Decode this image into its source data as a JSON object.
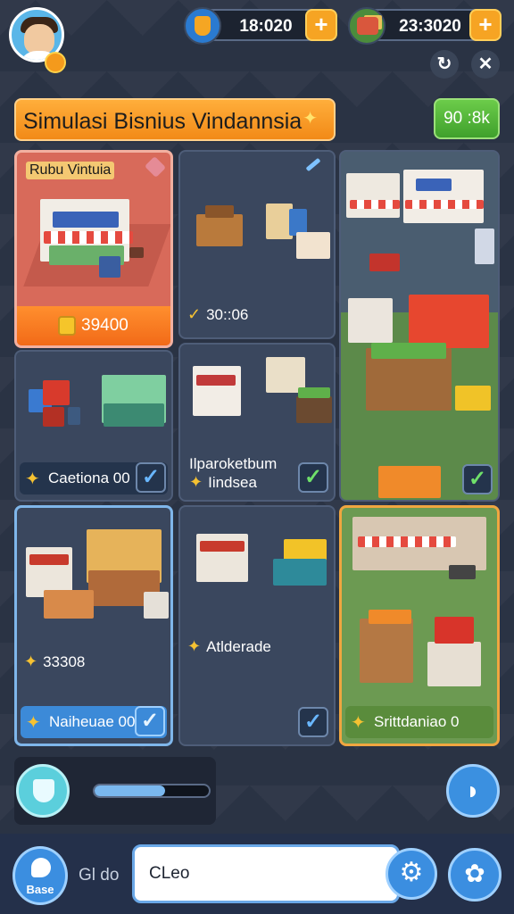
{
  "header": {
    "currency_1": "18:020",
    "currency_2": "23:3020",
    "plus_symbol": "+",
    "refresh_icon": "↻",
    "close_icon": "✕"
  },
  "title": {
    "text": "Simulasi Bisnius Vindannsia",
    "spark": "✦"
  },
  "money_badge": "90 :8k",
  "tiles": [
    {
      "title": "Rubu Vintuia",
      "price": "39400"
    },
    {
      "label": "30::06",
      "spark": "✓"
    },
    {
      "check": "✓"
    },
    {
      "label": "Caetiona 00",
      "check": "✓"
    },
    {
      "label_line1": "Ilparoketbum",
      "label_line2": "Iindsea",
      "check": "✓"
    },
    {
      "label_top": "33308",
      "label": "Naiheuae 00",
      "check": "✓"
    },
    {
      "label": "Atlderade",
      "check": "✓"
    },
    {
      "label": "Srittdaniao 0"
    }
  ],
  "controls": {
    "slider_level": 0.62,
    "chat_icon": "chat-bubble-icon"
  },
  "bottom": {
    "home_label": "Base",
    "goto_label": "Gl do",
    "input_value": "CLeo",
    "settings_icon": "⚙",
    "profile_icon": "✿"
  },
  "colors": {
    "accent_orange": "#f28a17",
    "accent_green": "#3fa02c",
    "accent_blue": "#3b8ee0"
  }
}
